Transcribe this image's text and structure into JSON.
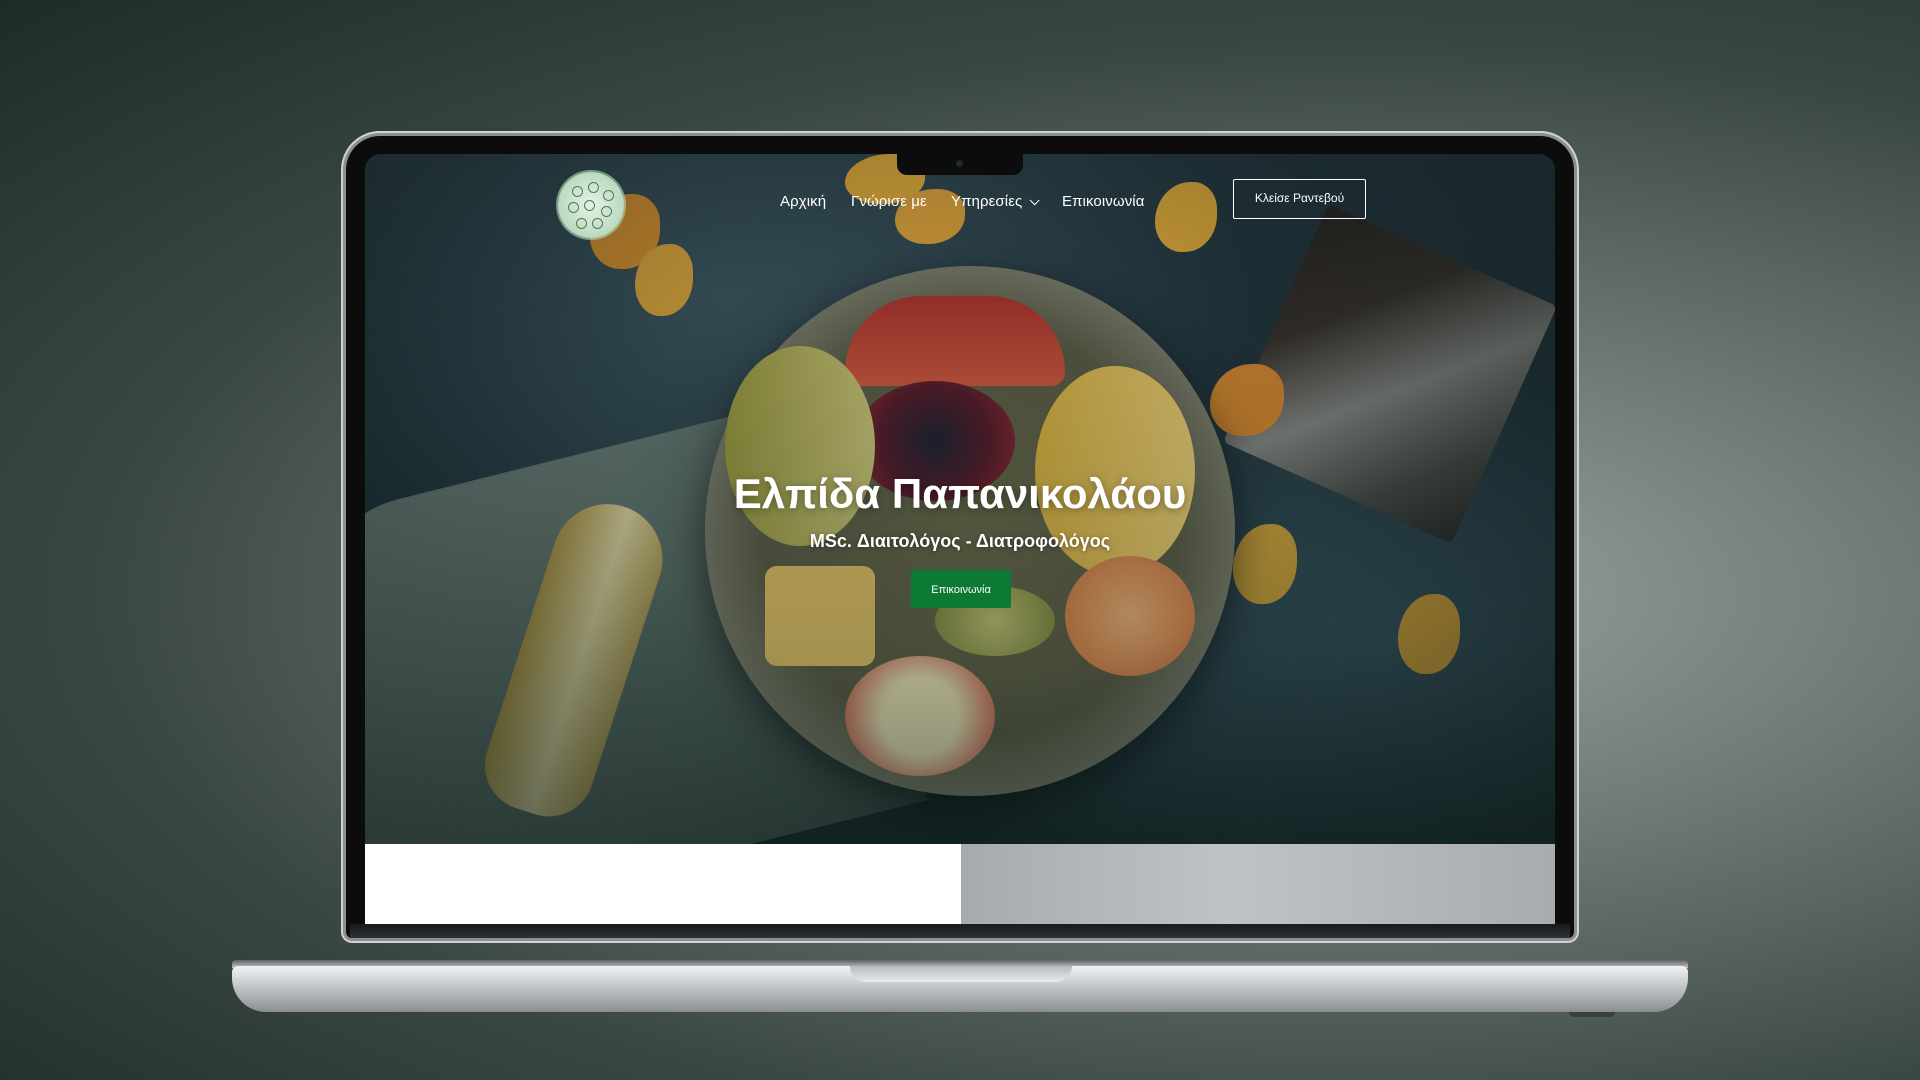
{
  "nav": {
    "items": [
      {
        "label": "Αρχική"
      },
      {
        "label": "Γνώρισε με"
      },
      {
        "label": "Υπηρεσίες"
      },
      {
        "label": "Επικοινωνία"
      }
    ],
    "cta_label": "Κλείσε Ραντεβού"
  },
  "hero": {
    "title": "Ελπίδα Παπανικολάου",
    "subtitle": "MSc. Διαιτολόγος - Διατροφολόγος",
    "button_label": "Επικοινωνία"
  },
  "icons": {
    "logo": "plant-pattern-logo",
    "services_dropdown": "chevron-down-icon"
  },
  "colors": {
    "accent": "#0c7a34",
    "text": "#ffffff"
  }
}
